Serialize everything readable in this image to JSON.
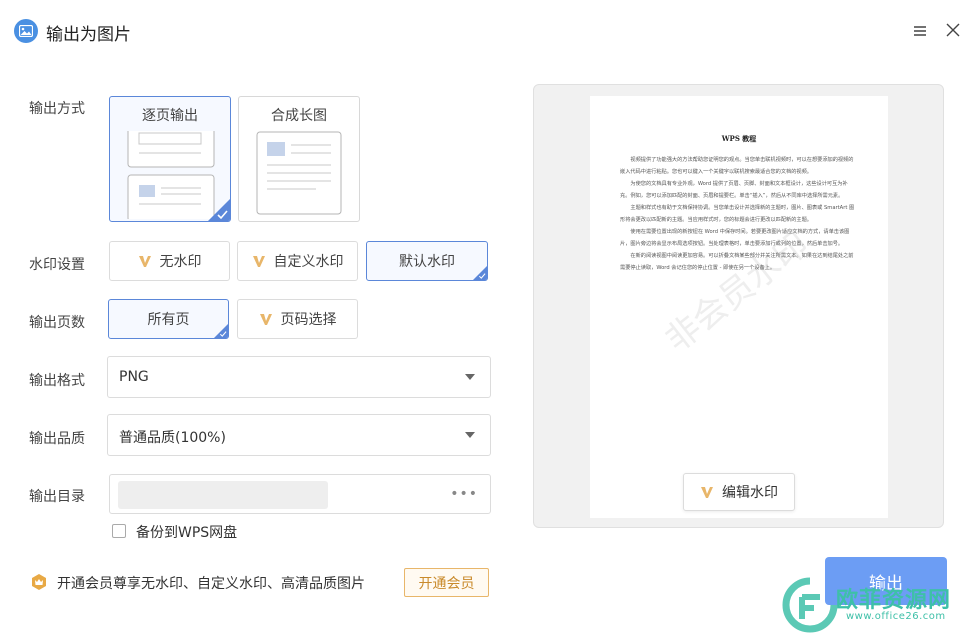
{
  "window": {
    "title": "输出为图片"
  },
  "labels": {
    "output_mode": "输出方式",
    "watermark": "水印设置",
    "pages": "输出页数",
    "format": "输出格式",
    "quality": "输出品质",
    "directory": "输出目录"
  },
  "output_mode": {
    "options": [
      "逐页输出",
      "合成长图"
    ],
    "selected": "逐页输出"
  },
  "watermark": {
    "options": [
      "无水印",
      "自定义水印",
      "默认水印"
    ],
    "selected": "默认水印"
  },
  "pages": {
    "options": [
      "所有页",
      "页码选择"
    ],
    "selected": "所有页"
  },
  "format": {
    "value": "PNG"
  },
  "quality": {
    "value": "普通品质(100%)"
  },
  "directory": {
    "more": "•••"
  },
  "backup": {
    "label": "备份到WPS网盘",
    "checked": false
  },
  "vip": {
    "text": "开通会员尊享无水印、自定义水印、高清品质图片",
    "button": "开通会员"
  },
  "preview": {
    "doc_title": "WPS 教程",
    "paragraphs": [
      "视频提供了功能强大的方法帮助您证明您的观点。当您单击联机视频时，可以在想要添加的视频的嵌入代码中进行粘贴。您也可以键入一个关键字以联机搜索最适合您的文档的视频。",
      "为使您的文档具有专业外观，Word 提供了页眉、页脚、封面和文本框设计，这些设计可互为补充。例如，您可以添加匹配的封面、页眉和提要栏。单击“插入”，然后从不同库中选择所需元素。",
      "主题和样式也有助于文档保持协调。当您单击设计并选择新的主题时，图片、图表或 SmartArt 图形将会更改以匹配新的主题。当应用样式时，您的标题会进行更改以匹配新的主题。",
      "使用在需要位置出现的新按钮在 Word 中保存时间。若要更改图片适应文档的方式，请单击该图片，图片旁边将会显示布局选项按钮。当处理表格时，单击要添加行或列的位置，然后单击加号。",
      "在新的阅读视图中阅读更加容易。可以折叠文档某些部分并关注所需文本。如果在达到结尾处之前需要停止读取，Word 会记住您的停止位置 - 即使在另一个设备上。"
    ],
    "watermark_text": "非会员水印",
    "edit_button": "编辑水印"
  },
  "export_button": "输出",
  "site": {
    "name": "欧菲资源网",
    "url": "www.office26.com"
  },
  "colors": {
    "accent": "#5b87d9",
    "primary_button": "#6c9df4",
    "vip_gold": "#e8b66a",
    "site_green": "#3ec0a8"
  }
}
